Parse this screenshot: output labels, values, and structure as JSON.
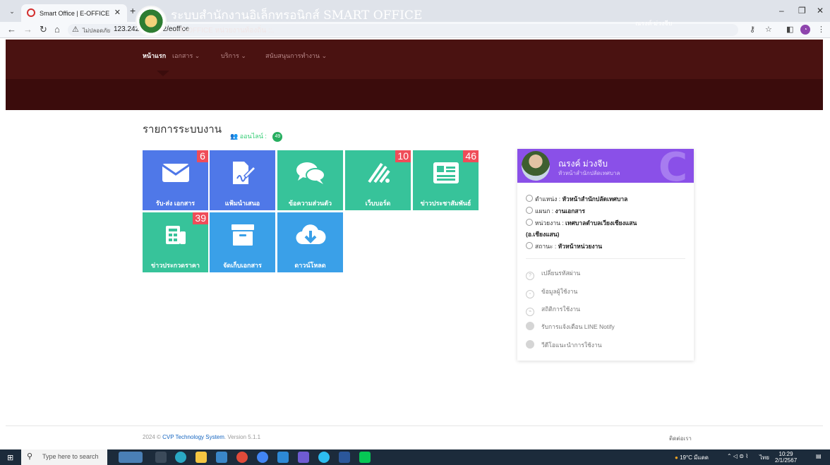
{
  "browser": {
    "tab_title": "Smart Office | E-OFFICE หน่วยงาน",
    "address_security": "ไม่ปลอดภัย",
    "address_url": "123.242.164.132/eoffice"
  },
  "header": {
    "title": "ระบบสำนักงานอิเล็กทรอนิกส์ SMART OFFICE",
    "subtitle": ".:: E-OFFICE หน่วยงานท้องถิ่น ::.",
    "user_name": "ณรงค์ ม่วงจีบ"
  },
  "nav": {
    "items": [
      {
        "label": "หน้าแรก"
      },
      {
        "label": "เอกสาร ⌄"
      },
      {
        "label": "บริการ ⌄"
      },
      {
        "label": "สนับสนุนการทำงาน ⌄"
      }
    ]
  },
  "main": {
    "section_title": "รายการระบบงาน",
    "online_label": "ออนไลน์ :",
    "online_count": "49",
    "tiles": [
      {
        "label": "รับ-ส่ง เอกสาร",
        "badge": "6",
        "icon": "envelope-icon",
        "color": "#4f78e8"
      },
      {
        "label": "แฟ้มนำเสนอ",
        "badge": "",
        "icon": "document-sign-icon",
        "color": "#4f78e8"
      },
      {
        "label": "ข้อความส่วนตัว",
        "badge": "",
        "icon": "chat-bubbles-icon",
        "color": "#37c39a"
      },
      {
        "label": "เว็บบอร์ด",
        "badge": "10",
        "icon": "webboard-icon",
        "color": "#37c39a"
      },
      {
        "label": "ข่าวประชาสัมพันธ์",
        "badge": "46",
        "icon": "newspaper-icon",
        "color": "#37c39a"
      },
      {
        "label": "ข่าวประกวดราคา",
        "badge": "39",
        "icon": "bid-news-icon",
        "color": "#37c39a"
      },
      {
        "label": "จัดเก็บเอกสาร",
        "badge": "",
        "icon": "archive-box-icon",
        "color": "#3aa0e8"
      },
      {
        "label": "ดาวน์โหลด",
        "badge": "",
        "icon": "cloud-download-icon",
        "color": "#3aa0e8"
      }
    ]
  },
  "profile_card": {
    "name": "ณรงค์ ม่วงจีบ",
    "role": "หัวหน้าสำนักปลัดเทศบาล",
    "info": [
      {
        "label": "ตำแหน่ง :",
        "value": "หัวหน้าสำนักปลัดเทศบาล"
      },
      {
        "label": "แผนก :",
        "value": "งานเอกสาร"
      },
      {
        "label": "หน่วยงาน :",
        "value": "เทศบาลตำบลเวียงเชียงแสน"
      },
      {
        "label": "",
        "value": "(อ.เชียงแสน)"
      },
      {
        "label": "สถานะ :",
        "value": "หัวหน้าหน่วยงาน"
      }
    ],
    "menu": [
      {
        "label": "เปลี่ยนรหัสผ่าน",
        "icon": "key-icon"
      },
      {
        "label": "ข้อมูลผู้ใช้งาน",
        "icon": "user-info-icon"
      },
      {
        "label": "สถิติการใช้งาน",
        "icon": "stats-icon"
      },
      {
        "label": "รับการแจ้งเตือน LINE Notify",
        "icon": "line-chat-icon"
      },
      {
        "label": "วีดีโอแนะนำการใช้งาน",
        "icon": "video-icon"
      }
    ]
  },
  "footer": {
    "year": "2024 ©",
    "company": "CVP Technology System",
    "version": "Version 5.1.1",
    "contact": "ติดต่อเรา"
  },
  "taskbar": {
    "search_placeholder": "Type here to search",
    "weather": "19°C มีแดด",
    "language": "ไทย",
    "time": "10:29",
    "date": "2/1/2567"
  }
}
